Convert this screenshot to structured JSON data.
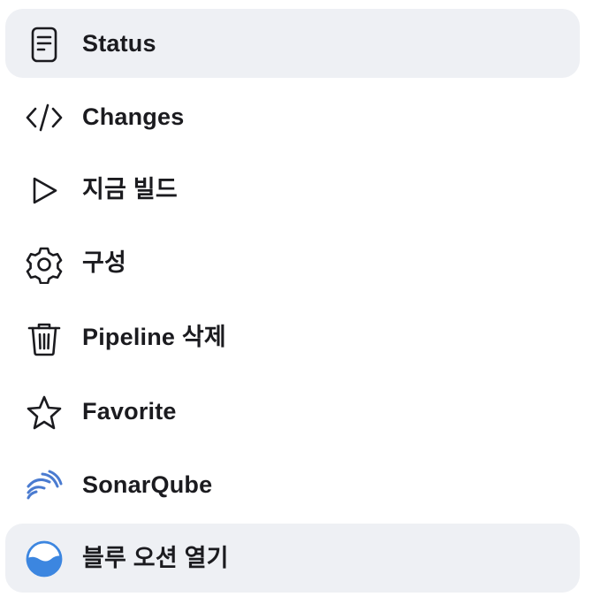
{
  "tasks": [
    {
      "label": "Status",
      "icon": "document-icon",
      "active": true
    },
    {
      "label": "Changes",
      "icon": "code-icon",
      "active": false
    },
    {
      "label": "지금 빌드",
      "icon": "play-icon",
      "active": false
    },
    {
      "label": "구성",
      "icon": "gear-icon",
      "active": false
    },
    {
      "label": "Pipeline 삭제",
      "icon": "trash-icon",
      "active": false
    },
    {
      "label": "Favorite",
      "icon": "star-icon",
      "active": false
    },
    {
      "label": "SonarQube",
      "icon": "sonarqube-icon",
      "active": false
    },
    {
      "label": "블루 오션 열기",
      "icon": "blue-ocean-icon",
      "active": true
    }
  ],
  "colors": {
    "active_bg": "#eef0f4",
    "text": "#1b1b1f",
    "sonar_blue": "#4a7bd0",
    "ocean_blue": "#3c86e0"
  }
}
